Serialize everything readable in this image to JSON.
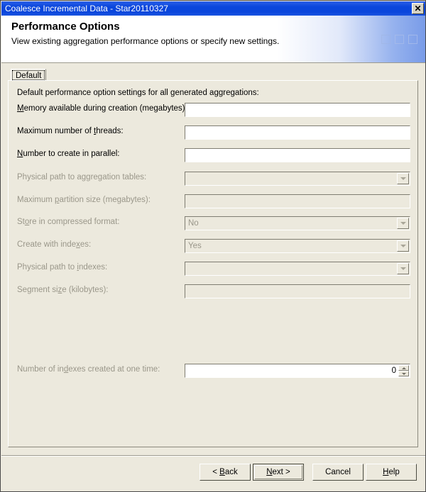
{
  "window": {
    "title": "Coalesce Incremental Data - Star20110327",
    "close_label": "✕"
  },
  "header": {
    "title": "Performance Options",
    "subtitle": "View existing aggregation performance options or specify new settings."
  },
  "tabs": [
    {
      "label": "Default",
      "selected": true
    }
  ],
  "panel": {
    "note": "Default performance option settings for all generated aggregations:"
  },
  "fields": [
    {
      "label_before": "",
      "label_accel": "M",
      "label_after": "emory available during creation (megabytes):",
      "control": "text",
      "value": "",
      "disabled": false
    },
    {
      "label_before": "Maximum number of ",
      "label_accel": "t",
      "label_after": "hreads:",
      "control": "text",
      "value": "",
      "disabled": false
    },
    {
      "label_before": "",
      "label_accel": "N",
      "label_after": "umber to create in parallel:",
      "control": "text",
      "value": "",
      "disabled": false
    },
    {
      "label_before": "Physical path to a",
      "label_accel": "gg",
      "label_after": "regation tables:",
      "control": "combo",
      "value": "",
      "disabled": true
    },
    {
      "label_before": "Maximum ",
      "label_accel": "p",
      "label_after": "artition size (megabytes):",
      "control": "text",
      "value": "",
      "disabled": true
    },
    {
      "label_before": "St",
      "label_accel": "o",
      "label_after": "re in compressed format:",
      "control": "combo",
      "value": "No",
      "disabled": true
    },
    {
      "label_before": "Create with inde",
      "label_accel": "x",
      "label_after": "es:",
      "control": "combo",
      "value": "Yes",
      "disabled": true
    },
    {
      "label_before": "Physical path to ",
      "label_accel": "i",
      "label_after": "ndexes:",
      "control": "combo",
      "value": "",
      "disabled": true
    },
    {
      "label_before": "Segment si",
      "label_accel": "z",
      "label_after": "e (kilobytes):",
      "control": "text",
      "value": "",
      "disabled": true
    },
    {
      "label_before": "Number of in",
      "label_accel": "d",
      "label_after": "exes created at one time:",
      "control": "spinner",
      "value": "0",
      "disabled": true,
      "label_disabled": true
    }
  ],
  "buttons": [
    {
      "before": "< ",
      "accel": "B",
      "after": "ack",
      "default": false,
      "spaced": false
    },
    {
      "before": "",
      "accel": "N",
      "after": "ext >",
      "default": true,
      "spaced": false
    },
    {
      "before": "Cancel",
      "accel": "",
      "after": "",
      "default": false,
      "spaced": true
    },
    {
      "before": "",
      "accel": "H",
      "after": "elp",
      "default": false,
      "spaced": false
    }
  ]
}
